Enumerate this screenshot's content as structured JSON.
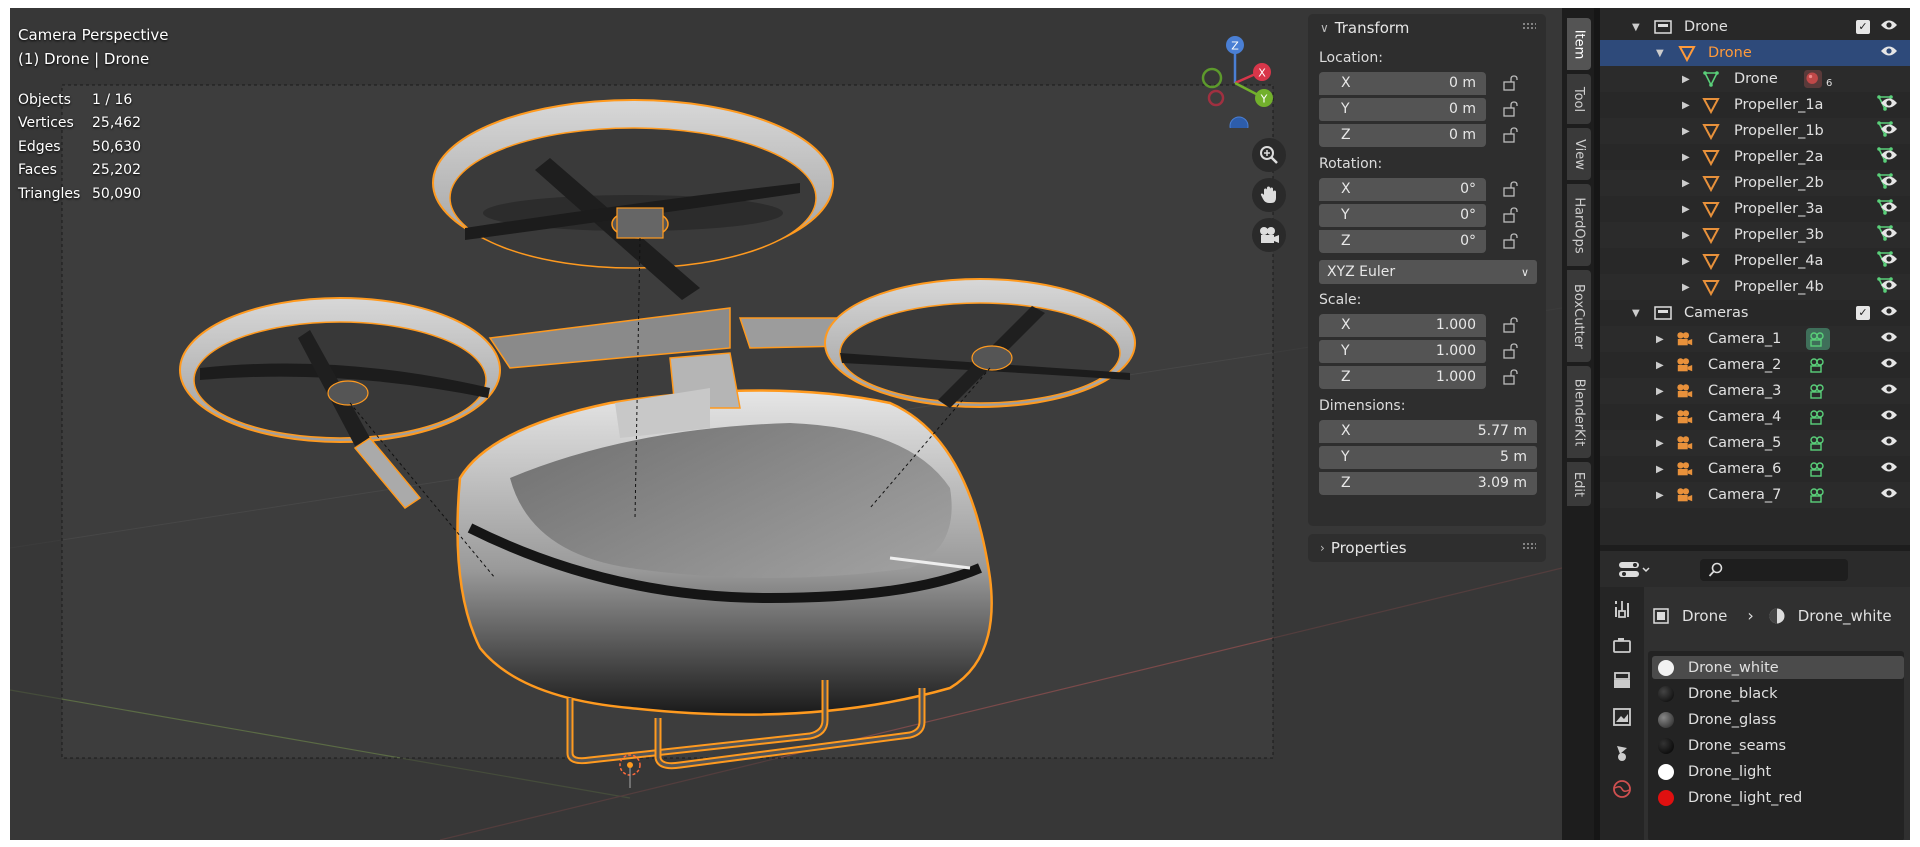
{
  "viewport": {
    "mode": "Camera Perspective",
    "object_label": "(1) Drone | Drone",
    "stats": [
      {
        "label": "Objects",
        "value": "1 / 16"
      },
      {
        "label": "Vertices",
        "value": "25,462"
      },
      {
        "label": "Edges",
        "value": "50,630"
      },
      {
        "label": "Faces",
        "value": "25,202"
      },
      {
        "label": "Triangles",
        "value": "50,090"
      }
    ],
    "gizmo": {
      "x": "X",
      "y": "Y",
      "z": "Z"
    },
    "nav_icons": [
      "zoom-icon",
      "pan-hand-icon",
      "camera-view-icon"
    ]
  },
  "transform": {
    "title": "Transform",
    "location_label": "Location:",
    "location": [
      {
        "axis": "X",
        "value": "0 m"
      },
      {
        "axis": "Y",
        "value": "0 m"
      },
      {
        "axis": "Z",
        "value": "0 m"
      }
    ],
    "rotation_label": "Rotation:",
    "rotation": [
      {
        "axis": "X",
        "value": "0°"
      },
      {
        "axis": "Y",
        "value": "0°"
      },
      {
        "axis": "Z",
        "value": "0°"
      }
    ],
    "rotation_mode": "XYZ Euler",
    "scale_label": "Scale:",
    "scale": [
      {
        "axis": "X",
        "value": "1.000"
      },
      {
        "axis": "Y",
        "value": "1.000"
      },
      {
        "axis": "Z",
        "value": "1.000"
      }
    ],
    "dimensions_label": "Dimensions:",
    "dimensions": [
      {
        "axis": "X",
        "value": "5.77 m"
      },
      {
        "axis": "Y",
        "value": "5 m"
      },
      {
        "axis": "Z",
        "value": "3.09 m"
      }
    ]
  },
  "properties_panel": {
    "title": "Properties"
  },
  "tabs": [
    "Item",
    "Tool",
    "View",
    "HardOps",
    "BoxCutter",
    "BlenderKit",
    "Edit"
  ],
  "outliner": {
    "rows": [
      {
        "label": "Drone",
        "type": "collection"
      },
      {
        "label": "Drone",
        "type": "object"
      },
      {
        "label": "Drone",
        "type": "mesh-data",
        "badge": "6"
      },
      {
        "label": "Propeller_1a",
        "type": "object"
      },
      {
        "label": "Propeller_1b",
        "type": "object"
      },
      {
        "label": "Propeller_2a",
        "type": "object"
      },
      {
        "label": "Propeller_2b",
        "type": "object"
      },
      {
        "label": "Propeller_3a",
        "type": "object"
      },
      {
        "label": "Propeller_3b",
        "type": "object"
      },
      {
        "label": "Propeller_4a",
        "type": "object"
      },
      {
        "label": "Propeller_4b",
        "type": "object"
      },
      {
        "label": "Cameras",
        "type": "collection"
      },
      {
        "label": "Camera_1",
        "type": "camera"
      },
      {
        "label": "Camera_2",
        "type": "camera"
      },
      {
        "label": "Camera_3",
        "type": "camera"
      },
      {
        "label": "Camera_4",
        "type": "camera"
      },
      {
        "label": "Camera_5",
        "type": "camera"
      },
      {
        "label": "Camera_6",
        "type": "camera"
      },
      {
        "label": "Camera_7",
        "type": "camera"
      }
    ]
  },
  "properties": {
    "breadcrumb_object": "Drone",
    "breadcrumb_material": "Drone_white",
    "materials": [
      {
        "name": "Drone_white",
        "color": "#f2f2f2"
      },
      {
        "name": "Drone_black",
        "color": "#111111"
      },
      {
        "name": "Drone_glass",
        "color": "#555555"
      },
      {
        "name": "Drone_seams",
        "color": "#0a0a0a"
      },
      {
        "name": "Drone_light",
        "color": "#ffffff"
      },
      {
        "name": "Drone_light_red",
        "color": "#e01010"
      }
    ]
  },
  "colors": {
    "selection": "#ff9a1f",
    "accent_blue": "#2e4a7a",
    "object_orange": "#e8913b",
    "mesh_green": "#5ad07a"
  }
}
